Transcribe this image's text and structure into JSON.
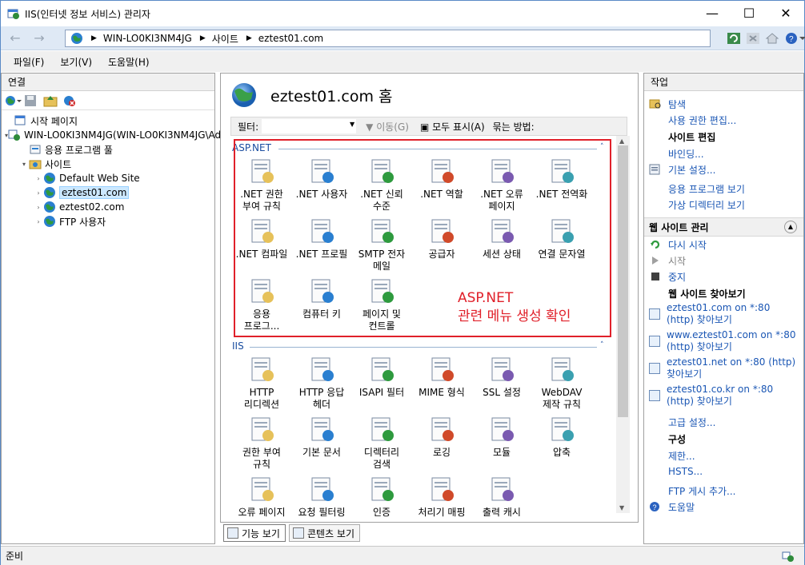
{
  "window": {
    "title": "IIS(인터넷 정보 서비스) 관리자"
  },
  "address": {
    "segments": [
      "WIN-LO0KI3NM4JG",
      "사이트",
      "eztest01.com"
    ]
  },
  "menu": [
    "파일(F)",
    "보기(V)",
    "도움말(H)"
  ],
  "connections": {
    "header": "연결",
    "tree": [
      {
        "label": "시작 페이지",
        "indent": 0,
        "expander": ""
      },
      {
        "label": "WIN-LO0KI3NM4JG(WIN-LO0KI3NM4JG\\Ad",
        "indent": 0,
        "expander": "▾"
      },
      {
        "label": "응용 프로그램 풀",
        "indent": 1,
        "expander": ""
      },
      {
        "label": "사이트",
        "indent": 1,
        "expander": "▾"
      },
      {
        "label": "Default Web Site",
        "indent": 2,
        "expander": "›"
      },
      {
        "label": "eztest01.com",
        "indent": 2,
        "expander": "›",
        "selected": true
      },
      {
        "label": "eztest02.com",
        "indent": 2,
        "expander": "›"
      },
      {
        "label": "FTP 사용자",
        "indent": 2,
        "expander": "›"
      }
    ]
  },
  "center": {
    "title": "eztest01.com 홈",
    "filter_label": "필터:",
    "go_label": "이동(G)",
    "show_all_label": "모두 표시(A)",
    "group_by_label": "묶는 방법:",
    "aspnet_header": "ASP.NET",
    "iis_header": "IIS",
    "aspnet_features": [
      ".NET 권한\n부여 규칙",
      ".NET 사용자",
      ".NET 신뢰\n수준",
      ".NET 역할",
      ".NET 오류\n페이지",
      ".NET 전역화",
      ".NET 컴파일",
      ".NET 프로필",
      "SMTP 전자\n메일",
      "공급자",
      "세션 상태",
      "연결 문자열",
      "응용\n프로그...",
      "컴퓨터 키",
      "페이지 및\n컨트롤"
    ],
    "iis_features": [
      "HTTP\n리디렉션",
      "HTTP 응답\n헤더",
      "ISAPI 필터",
      "MIME 형식",
      "SSL 설정",
      "WebDAV\n제작 규칙",
      "권한 부여\n규칙",
      "기본 문서",
      "디렉터리\n검색",
      "로깅",
      "모듈",
      "압축",
      "오류 페이지",
      "요청 필터링",
      "인증",
      "처리기 매핑",
      "출력 캐시"
    ],
    "annotation": [
      "ASP.NET",
      "관련 메뉴 생성 확인"
    ],
    "view_tabs": [
      "기능 보기",
      "콘텐츠 보기"
    ]
  },
  "actions": {
    "header": "작업",
    "top_links": [
      "탐색",
      "사용 권한 편집..."
    ],
    "edit_site_label": "사이트 편집",
    "edit_site_links": [
      "바인딩...",
      "기본 설정..."
    ],
    "app_links": [
      "응용 프로그램 보기",
      "가상 디렉터리 보기"
    ],
    "manage_label": "웹 사이트 관리",
    "manage_links": [
      "다시 시작",
      "시작",
      "중지"
    ],
    "browse_label": "웹 사이트 찾아보기",
    "browse_links": [
      "eztest01.com on *:80 (http) 찾아보기",
      "www.eztest01.com on *:80 (http) 찾아보기",
      "eztest01.net on *:80 (http) 찾아보기",
      "eztest01.co.kr on *:80 (http) 찾아보기"
    ],
    "advanced": "고급 설정...",
    "config_label": "구성",
    "config_links": [
      "제한...",
      "HSTS..."
    ],
    "ftp_link": "FTP 게시 추가...",
    "help": "도움말"
  },
  "status": {
    "text": "준비"
  },
  "colors": {
    "accent": "#1a56b4",
    "annotation": "#e0202a",
    "selection": "#cce8ff"
  }
}
